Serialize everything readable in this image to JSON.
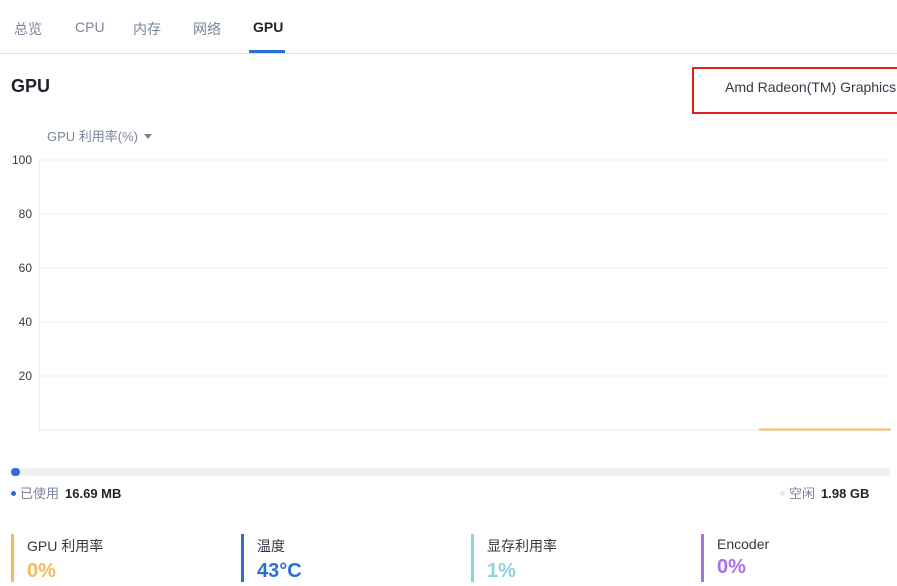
{
  "tabs": [
    {
      "label": "总览",
      "active": false
    },
    {
      "label": "CPU",
      "active": false
    },
    {
      "label": "内存",
      "active": false
    },
    {
      "label": "网络",
      "active": false
    },
    {
      "label": "GPU",
      "active": true
    }
  ],
  "page_title": "GPU",
  "device": {
    "name": "Amd Radeon(TM) Graphics"
  },
  "metric_selector": {
    "label": "GPU 利用率(%)",
    "icon": "chevron-down-icon"
  },
  "chart_data": {
    "type": "area",
    "title": "",
    "xlabel": "",
    "ylabel": "",
    "ylim": [
      0,
      100
    ],
    "yticks": [
      20,
      40,
      60,
      80,
      100
    ],
    "grid": true,
    "series": [
      {
        "color": "#f5b95c",
        "values": [
          0,
          0,
          0,
          0,
          0,
          0,
          0,
          0,
          0,
          0,
          0,
          0,
          0,
          0,
          0,
          0
        ]
      }
    ],
    "data_start_fraction": 0.845
  },
  "memory": {
    "used_fraction": 0.01,
    "used_label": "已使用",
    "used_value": "16.69 MB",
    "free_label": "空闲",
    "free_value": "1.98 GB",
    "used_color": "#2b6fd6",
    "free_color": "#e6e8eb"
  },
  "stats": [
    {
      "name": "GPU 利用率",
      "value": "0%",
      "color": "#f5b95c"
    },
    {
      "name": "温度",
      "value": "43°C",
      "color": "#2b6fd6"
    },
    {
      "name": "显存利用率",
      "value": "1%",
      "color": "#8fd3e0"
    },
    {
      "name": "Encoder",
      "value": "0%",
      "color": "#a86fe8"
    }
  ]
}
